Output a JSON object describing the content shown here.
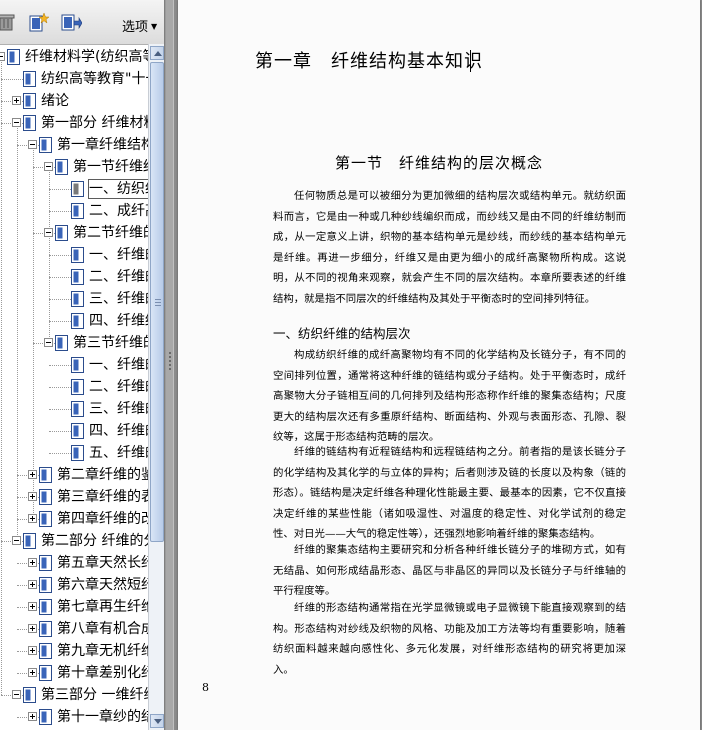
{
  "toolbar": {
    "options_label": "选项",
    "icons": [
      "trash-icon",
      "new-bookmark-icon",
      "bookmark-export-icon"
    ]
  },
  "bookmarks": [
    {
      "label": "纤维材料学(纺织高等教育\"十一五\"部委级规划教材本科)",
      "level": 0,
      "toggle": "minus"
    },
    {
      "label": "纺织高等教育\"十一五\"部委级规划教材本科",
      "level": 1,
      "toggle": "none"
    },
    {
      "label": "绪论",
      "level": 1,
      "toggle": "plus"
    },
    {
      "label": "第一部分 纤维材料的结构与性能",
      "level": 1,
      "toggle": "minus"
    },
    {
      "label": "第一章纤维结构基本知识",
      "level": 2,
      "toggle": "minus"
    },
    {
      "label": "第一节纤维结构的层次概念",
      "level": 3,
      "toggle": "minus"
    },
    {
      "label": "一、纺织纤维的结构层次",
      "level": 4,
      "toggle": "none",
      "selected": true
    },
    {
      "label": "二、成纤高聚物的基本条件",
      "level": 4,
      "toggle": "none"
    },
    {
      "label": "第二节纤维的结构",
      "level": 3,
      "toggle": "minus"
    },
    {
      "label": "一、纤维的分子结构",
      "level": 4,
      "toggle": "none"
    },
    {
      "label": "二、纤维的聚集态结构",
      "level": 4,
      "toggle": "none"
    },
    {
      "label": "三、纤维的形态结构",
      "level": 4,
      "toggle": "none"
    },
    {
      "label": "四、纤维结构的表征",
      "level": 4,
      "toggle": "none"
    },
    {
      "label": "第三节纤维的性能",
      "level": 3,
      "toggle": "minus"
    },
    {
      "label": "一、纤维的力学性能",
      "level": 4,
      "toggle": "none"
    },
    {
      "label": "二、纤维的热学性能",
      "level": 4,
      "toggle": "none"
    },
    {
      "label": "三、纤维的光学性能",
      "level": 4,
      "toggle": "none"
    },
    {
      "label": "四、纤维的电学性能",
      "level": 4,
      "toggle": "none"
    },
    {
      "label": "五、纤维的吸湿性能",
      "level": 4,
      "toggle": "none"
    },
    {
      "label": "第二章纤维的鉴别",
      "level": 2,
      "toggle": "plus"
    },
    {
      "label": "第三章纤维的表征方法",
      "level": 2,
      "toggle": "plus"
    },
    {
      "label": "第四章纤维的改性",
      "level": 2,
      "toggle": "plus"
    },
    {
      "label": "第二部分 纤维的分类",
      "level": 1,
      "toggle": "minus"
    },
    {
      "label": "第五章天然长纤维",
      "level": 2,
      "toggle": "plus"
    },
    {
      "label": "第六章天然短纤维",
      "level": 2,
      "toggle": "plus"
    },
    {
      "label": "第七章再生纤维",
      "level": 2,
      "toggle": "plus"
    },
    {
      "label": "第八章有机合成纤维",
      "level": 2,
      "toggle": "plus"
    },
    {
      "label": "第九章无机纤维",
      "level": 2,
      "toggle": "plus"
    },
    {
      "label": "第十章差别化纤维",
      "level": 2,
      "toggle": "plus"
    },
    {
      "label": "第三部分 一维纤维集合体",
      "level": 1,
      "toggle": "minus"
    },
    {
      "label": "第十一章纱的结构",
      "level": 2,
      "toggle": "plus"
    }
  ],
  "document": {
    "chapter_title": "第一章　纤维结构基本知识",
    "section_title": "第一节　纤维结构的层次概念",
    "paragraphs": [
      "任何物质总是可以被细分为更加微细的结构层次或结构单元。就纺织面料而言，它是由一种或几种纱线编织而成，而纱线又是由不同的纤维纺制而成，从一定意义上讲，织物的基本结构单元是纱线，而纱线的基本结构单元是纤维。再进一步细分，纤维又是由更为细小的成纤高聚物所构成。这说明，从不同的视角来观察，就会产生不同的层次结构。本章所要表述的纤维结构，就是指不同层次的纤维结构及其处于平衡态时的空间排列特征。"
    ],
    "subheading": "一、纺织纤维的结构层次",
    "paragraphs2": [
      "构成纺织纤维的成纤高聚物均有不同的化学结构及长链分子，有不同的空间排列位置，通常将这种纤维的链结构或分子结构。处于平衡态时，成纤高聚物大分子链相互间的几何排列及结构形态称作纤维的聚集态结构；尺度更大的结构层次还有多重原纤结构、断面结构、外观与表面形态、孔隙、裂纹等，这属于形态结构范畴的层次。",
      "纤维的链结构有近程链结构和远程链结构之分。前者指的是该长链分子的化学结构及其化学的与立体的异构；后者则涉及链的长度以及构象（链的形态）。链结构是决定纤维各种理化性能最主要、最基本的因素，它不仅直接决定纤维的某些性能（诸如吸湿性、对温度的稳定性、对化学试剂的稳定性、对日光——大气的稳定性等），还强烈地影响着纤维的聚集态结构。",
      "纤维的聚集态结构主要研究和分析各种纤维长链分子的堆砌方式，如有无结晶、如何形成结晶形态、晶区与非晶区的异同以及长链分子与纤维轴的平行程度等。",
      "纤维的形态结构通常指在光学显微镜或电子显微镜下能直接观察到的结构。形态结构对纱线及织物的风格、功能及加工方法等均有重要影响，随着纺织面料越来越向感性化、多元化发展，对纤维形态结构的研究将更加深入。"
    ],
    "page_number": "8"
  }
}
